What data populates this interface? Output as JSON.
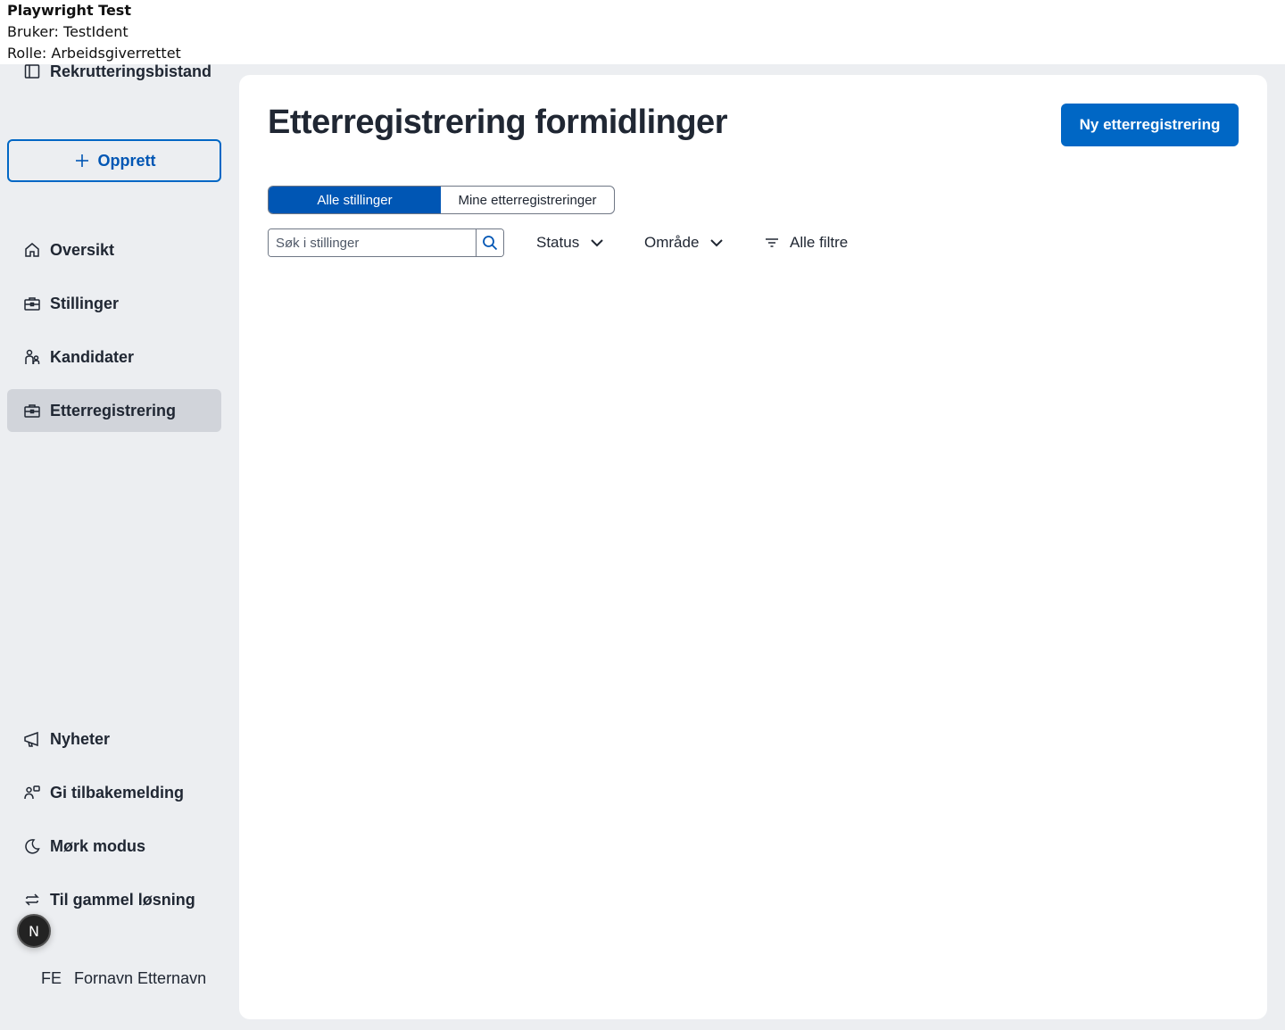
{
  "topbar": {
    "title": "Playwright Test",
    "user": "Bruker: TestIdent",
    "role": "Rolle: Arbeidsgiverrettet"
  },
  "sidebar": {
    "brand": "Rekrutteringsbistand",
    "create_label": "Opprett",
    "nav": [
      {
        "label": "Oversikt",
        "icon": "home-icon"
      },
      {
        "label": "Stillinger",
        "icon": "briefcase-icon"
      },
      {
        "label": "Kandidater",
        "icon": "people-icon"
      },
      {
        "label": "Etterregistrering",
        "icon": "briefcase-icon",
        "active": true
      }
    ],
    "bottom": [
      {
        "label": "Nyheter",
        "icon": "megaphone-icon"
      },
      {
        "label": "Gi tilbakemelding",
        "icon": "feedback-icon"
      },
      {
        "label": "Mørk modus",
        "icon": "moon-icon"
      },
      {
        "label": "Til gammel løsning",
        "icon": "arrows-swap-icon"
      }
    ],
    "badge": "N",
    "user_initials": "FE",
    "user_name": "Fornavn Etternavn"
  },
  "main": {
    "title": "Etterregistrering formidlinger",
    "new_button": "Ny etterregistrering",
    "toggle": {
      "selected": "Alle stillinger",
      "other": "Mine etterregistreringer"
    },
    "search": {
      "placeholder": "Søk i stillinger",
      "value": ""
    },
    "filters": {
      "status": "Status",
      "area": "Område",
      "all": "Alle filtre"
    }
  },
  "colors": {
    "accent": "#0067c5",
    "accent_dark": "#0056b4",
    "sidebar_bg": "#eceef1",
    "active_bg": "#d1d4da",
    "text": "#202733"
  }
}
